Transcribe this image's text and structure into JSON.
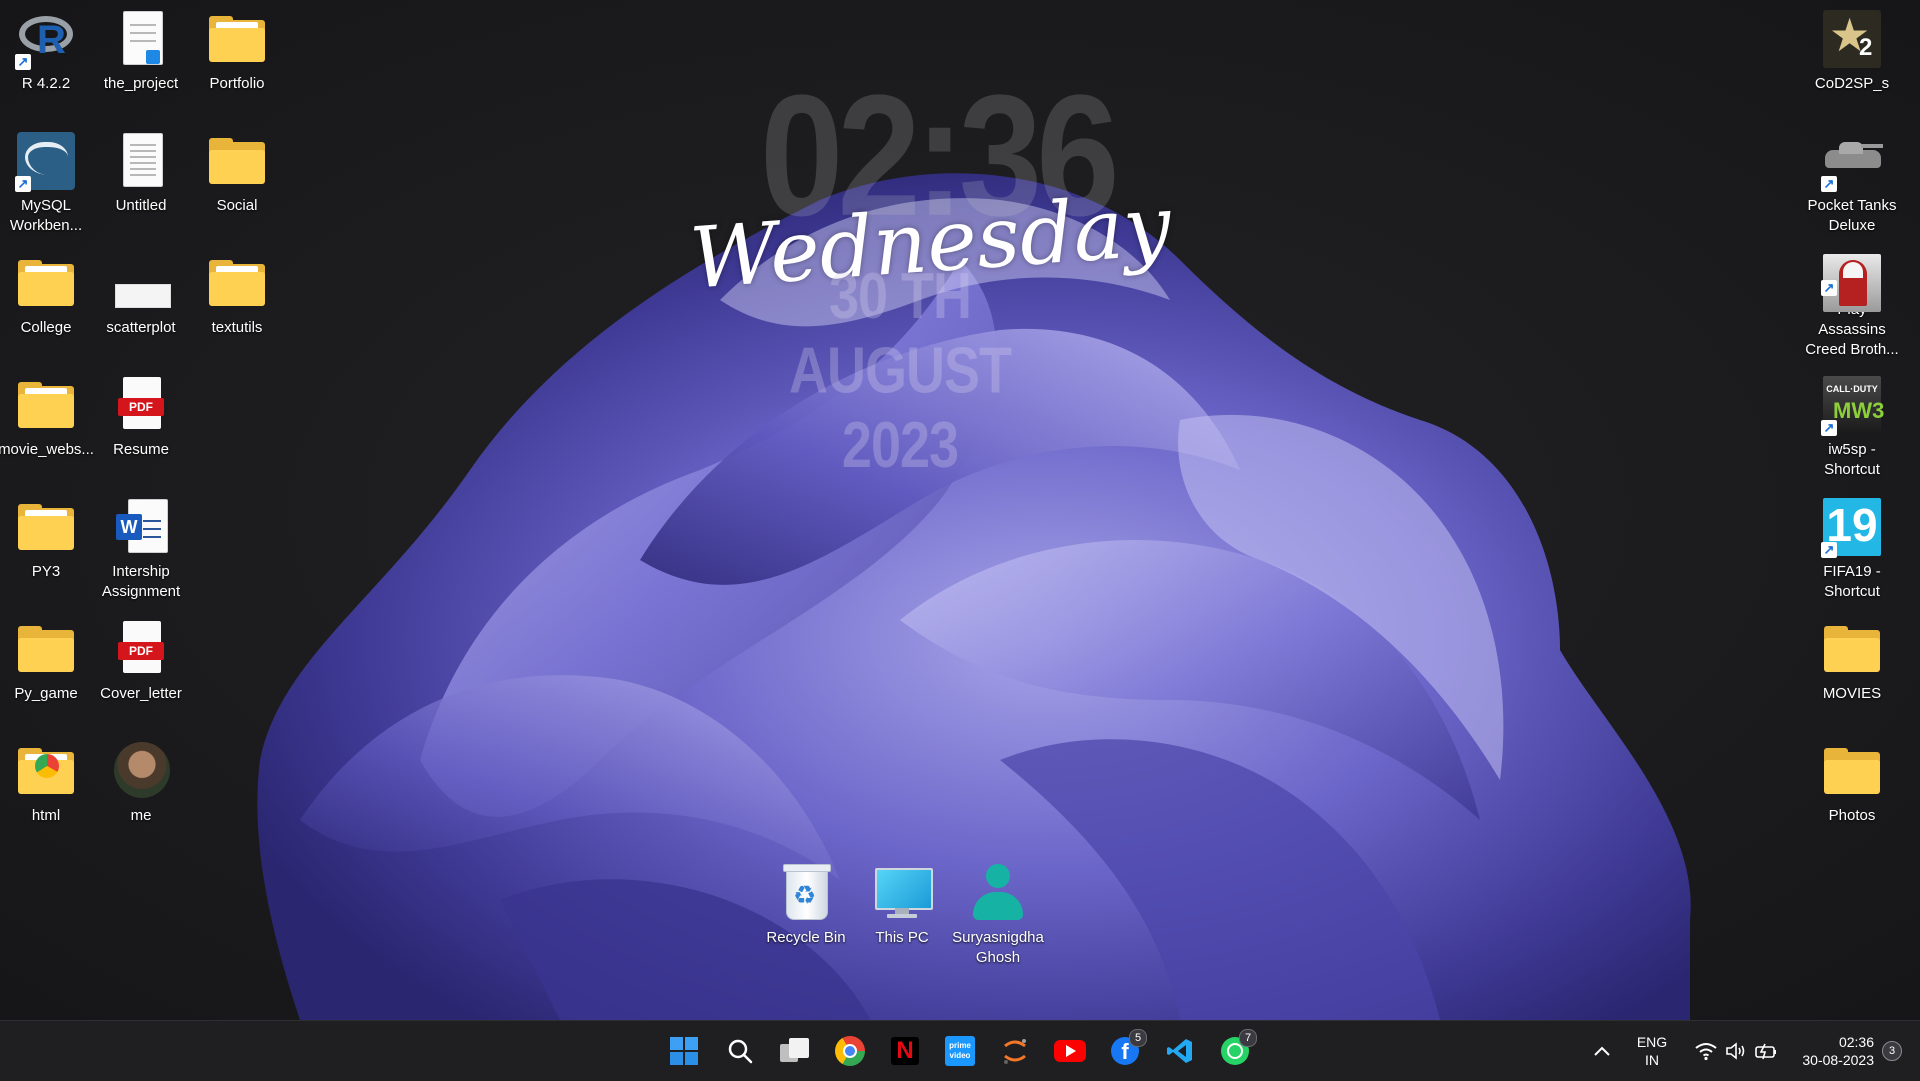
{
  "clock_widget": {
    "time": "02:36",
    "day": "Wednesday",
    "date": "30 TH AUGUST 2023"
  },
  "desktop": {
    "col1": [
      {
        "label": "R 4.2.2",
        "icon": "r-app-icon"
      },
      {
        "label": "MySQL Workben...",
        "icon": "mysql-workbench-icon"
      },
      {
        "label": "College",
        "icon": "folder-icon"
      },
      {
        "label": "movie_webs...",
        "icon": "folder-icon"
      },
      {
        "label": "PY3",
        "icon": "folder-icon"
      },
      {
        "label": "Py_game",
        "icon": "folder-icon"
      },
      {
        "label": "html",
        "icon": "folder-icon"
      }
    ],
    "col2": [
      {
        "label": "the_project",
        "icon": "code-file-icon"
      },
      {
        "label": "Untitled",
        "icon": "text-file-icon"
      },
      {
        "label": "scatterplot",
        "icon": "image-file-icon"
      },
      {
        "label": "Resume",
        "icon": "pdf-file-icon",
        "badge": "PDF"
      },
      {
        "label": "Intership Assignment",
        "icon": "word-document-icon"
      },
      {
        "label": "Cover_letter",
        "icon": "pdf-file-icon",
        "badge": "PDF"
      },
      {
        "label": "me",
        "icon": "photo-avatar-icon"
      }
    ],
    "col3": [
      {
        "label": "Portfolio",
        "icon": "folder-icon"
      },
      {
        "label": "Social",
        "icon": "folder-icon"
      },
      {
        "label": "textutils",
        "icon": "folder-icon"
      }
    ],
    "right": [
      {
        "label": "CoD2SP_s",
        "icon": "cod2-game-icon",
        "badge": "2"
      },
      {
        "label": "Pocket Tanks Deluxe",
        "icon": "tank-game-icon"
      },
      {
        "label": "Play Assassins Creed Broth...",
        "icon": "assassins-creed-icon"
      },
      {
        "label": "iw5sp - Shortcut",
        "icon": "call-of-duty-icon",
        "badge": "CALL·DUTY"
      },
      {
        "label": "FIFA19 - Shortcut",
        "icon": "fifa19-icon",
        "badge": "19"
      },
      {
        "label": "MOVIES",
        "icon": "folder-icon"
      },
      {
        "label": "Photos",
        "icon": "folder-icon"
      }
    ],
    "bottom": [
      {
        "label": "Recycle Bin",
        "icon": "recycle-bin-icon"
      },
      {
        "label": "This PC",
        "icon": "this-pc-icon"
      },
      {
        "label": "Suryasnigdha Ghosh",
        "icon": "user-folder-icon"
      }
    ]
  },
  "taskbar": {
    "apps": [
      {
        "name": "start-button",
        "icon": "windows-logo-icon"
      },
      {
        "name": "search-button",
        "icon": "search-icon"
      },
      {
        "name": "task-view-button",
        "icon": "task-view-icon"
      },
      {
        "name": "chrome-button",
        "icon": "chrome-icon"
      },
      {
        "name": "netflix-button",
        "icon": "netflix-icon"
      },
      {
        "name": "prime-video-button",
        "icon": "prime-video-icon",
        "text": "prime video"
      },
      {
        "name": "jupyter-button",
        "icon": "jupyter-icon"
      },
      {
        "name": "youtube-button",
        "icon": "youtube-icon"
      },
      {
        "name": "facebook-button",
        "icon": "facebook-icon",
        "badge": "5"
      },
      {
        "name": "vscode-button",
        "icon": "vscode-icon"
      },
      {
        "name": "whatsapp-button",
        "icon": "whatsapp-icon",
        "badge": "7"
      }
    ],
    "tray": {
      "language_line1": "ENG",
      "language_line2": "IN",
      "time": "02:36",
      "date": "30-08-2023",
      "notification_count": "3"
    }
  },
  "colors": {
    "folder": "#ffd153",
    "wallpaper_bloom": "#6a64c8",
    "taskbar_bg": "#1f1f22"
  }
}
